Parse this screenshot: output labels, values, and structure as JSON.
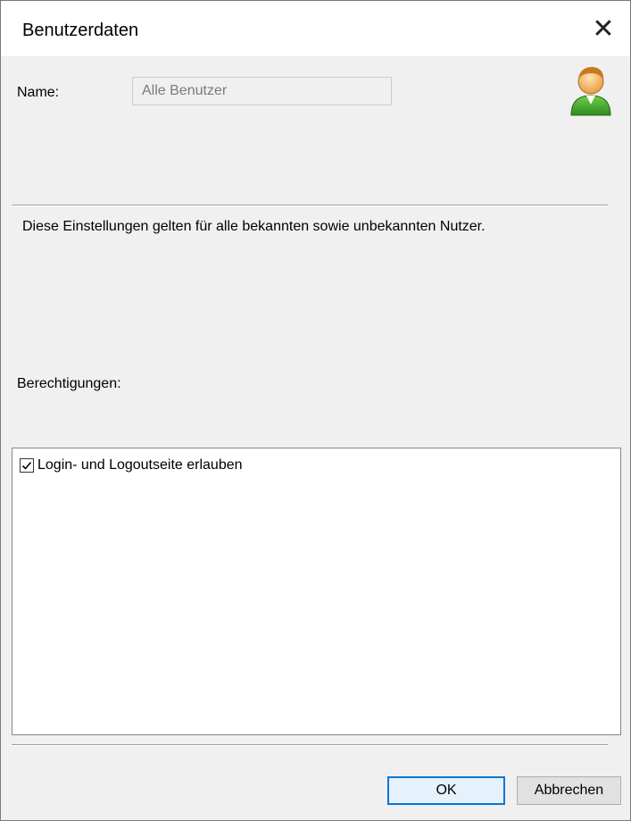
{
  "window": {
    "title": "Benutzerdaten",
    "close_label": "✕"
  },
  "user": {
    "name_label": "Name:",
    "name_value": "Alle Benutzer",
    "icon": "user-icon"
  },
  "info": {
    "text": "Diese Einstellungen gelten für alle  bekannten sowie unbekannten Nutzer."
  },
  "permissions": {
    "label": "Berechtigungen:",
    "items": [
      {
        "label": "Login- und Logoutseite erlauben",
        "checked": true
      }
    ]
  },
  "buttons": {
    "ok": "OK",
    "cancel": "Abbrechen"
  },
  "colors": {
    "accent": "#0078d7",
    "background": "#f0f0f0"
  }
}
